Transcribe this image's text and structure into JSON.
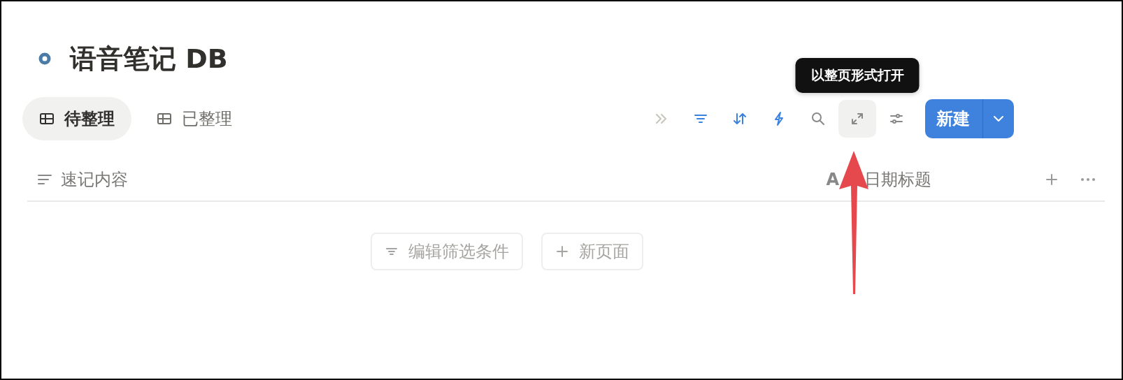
{
  "database": {
    "title": "语音笔记 DB"
  },
  "views": [
    {
      "label": "待整理",
      "selected": true
    },
    {
      "label": "已整理",
      "selected": false
    }
  ],
  "toolbar": {
    "tools": [
      {
        "kind": "collapse",
        "active": false
      },
      {
        "kind": "filter",
        "active": true
      },
      {
        "kind": "sort",
        "active": true
      },
      {
        "kind": "automation",
        "active": true
      },
      {
        "kind": "search",
        "active": false
      },
      {
        "kind": "expand",
        "active": false,
        "hovered": true
      },
      {
        "kind": "settings",
        "active": false
      }
    ],
    "tooltip": "以整页形式打开",
    "new_button": "新建"
  },
  "columns": [
    {
      "kind": "text",
      "label": "速记内容"
    },
    {
      "kind": "title",
      "type_mark": "A",
      "label": "日期标题"
    }
  ],
  "empty_actions": [
    {
      "kind": "filter",
      "label": "编辑筛选条件"
    },
    {
      "kind": "add",
      "label": "新页面"
    }
  ],
  "annotation": {
    "kind": "arrow"
  }
}
